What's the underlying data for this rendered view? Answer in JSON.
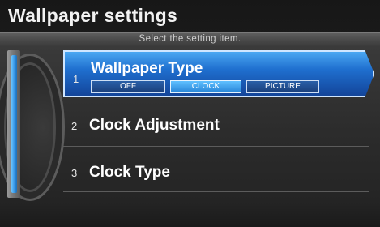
{
  "header": {
    "title": "Wallpaper settings",
    "subtitle": "Select the setting item."
  },
  "menu": {
    "items": [
      {
        "number": "1",
        "label": "Wallpaper Type",
        "selected": true,
        "options": [
          "OFF",
          "CLOCK",
          "PICTURE"
        ],
        "active_option": "CLOCK"
      },
      {
        "number": "2",
        "label": "Clock Adjustment",
        "selected": false
      },
      {
        "number": "3",
        "label": "Clock Type",
        "selected": false
      }
    ]
  },
  "colors": {
    "selected_row": "#1f6fcf",
    "scroll_thumb": "#2f8fe0",
    "background": "#1b1b1b"
  }
}
